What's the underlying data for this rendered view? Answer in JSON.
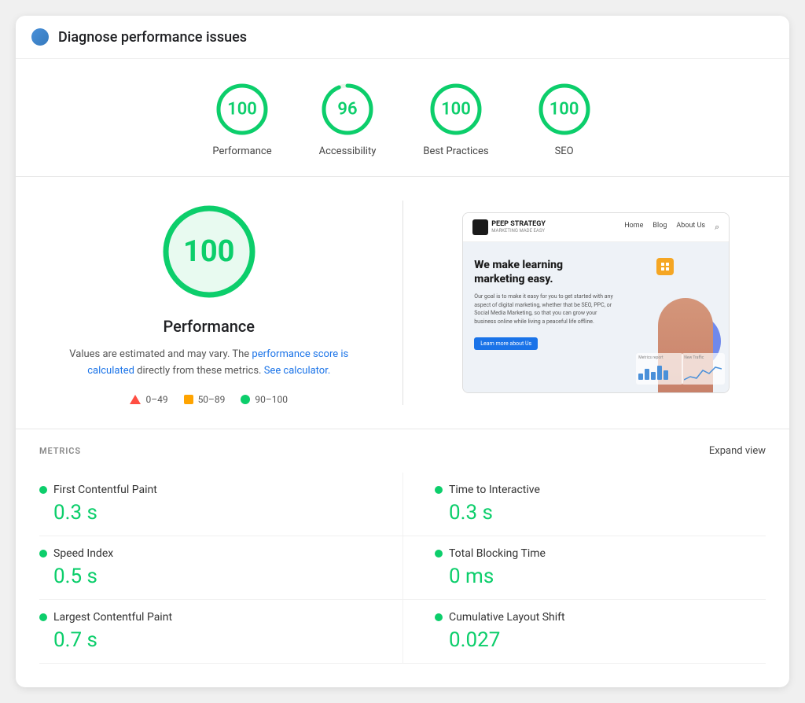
{
  "header": {
    "title": "Diagnose performance issues",
    "icon": "diagnostic-icon"
  },
  "scores": [
    {
      "label": "Performance",
      "value": "100",
      "color": "green"
    },
    {
      "label": "Accessibility",
      "value": "96",
      "color": "green"
    },
    {
      "label": "Best Practices",
      "value": "100",
      "color": "green"
    },
    {
      "label": "SEO",
      "value": "100",
      "color": "green"
    }
  ],
  "main": {
    "big_score": "100",
    "title": "Performance",
    "description_part1": "Values are estimated and may vary. The",
    "description_link1": "performance score is calculated",
    "description_part2": "directly from these metrics.",
    "description_link2": "See calculator.",
    "legend": [
      {
        "label": "0–49",
        "type": "triangle"
      },
      {
        "label": "50–89",
        "type": "square"
      },
      {
        "label": "90–100",
        "type": "circle"
      }
    ]
  },
  "screenshot": {
    "site_name": "PEEP STRATEGY",
    "site_tagline": "MARKETING MADE EASY",
    "nav": [
      "Home",
      "Blog",
      "About Us"
    ],
    "headline": "We make learning marketing easy.",
    "sub_text": "Our goal is to make it easy for you to get started with any aspect of digital marketing, whether that be SEO, PPC, or Social Media Marketing, so that you can grow your business online while living a peaceful life offline.",
    "cta": "Learn more about Us"
  },
  "metrics": {
    "section_title": "METRICS",
    "expand_label": "Expand view",
    "items": [
      {
        "name": "First Contentful Paint",
        "value": "0.3 s",
        "color": "green"
      },
      {
        "name": "Time to Interactive",
        "value": "0.3 s",
        "color": "green"
      },
      {
        "name": "Speed Index",
        "value": "0.5 s",
        "color": "green"
      },
      {
        "name": "Total Blocking Time",
        "value": "0 ms",
        "color": "green"
      },
      {
        "name": "Largest Contentful Paint",
        "value": "0.7 s",
        "color": "green"
      },
      {
        "name": "Cumulative Layout Shift",
        "value": "0.027",
        "color": "green"
      }
    ]
  }
}
